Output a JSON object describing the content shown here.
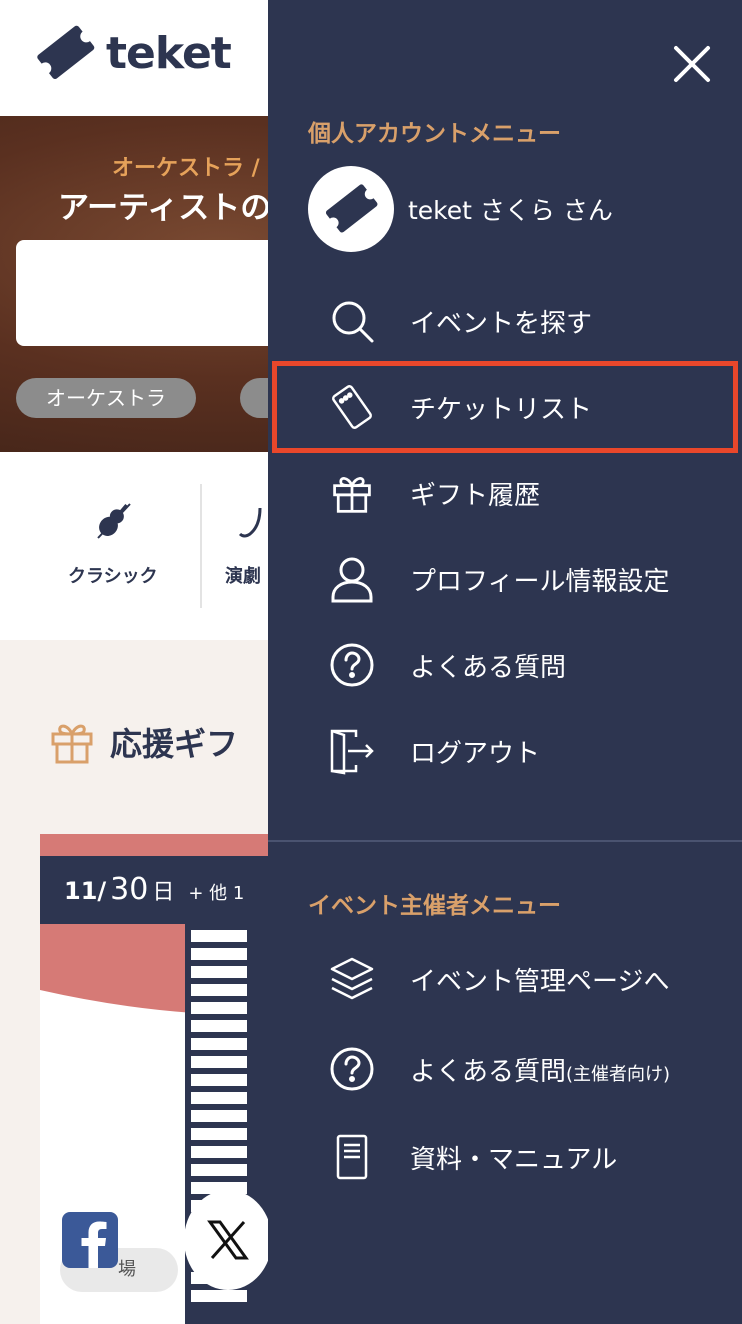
{
  "header": {
    "logo_text": "teket"
  },
  "hero": {
    "subtitle": "オーケストラ /",
    "title": "アーティストの",
    "chips": [
      "オーケストラ"
    ]
  },
  "categories": [
    {
      "label": "クラシック",
      "icon": "violin-icon"
    },
    {
      "label": "演劇",
      "icon": "theater-mask-icon"
    }
  ],
  "gift_section": {
    "heading": "応援ギフ"
  },
  "event_card": {
    "date_month_day": "11/",
    "date_day": "30",
    "weekday": "日",
    "more": "+ 他 1",
    "venue_partial": "場"
  },
  "drawer": {
    "personal_menu_title": "個人アカウントメニュー",
    "user_name": "teket さくら さん",
    "personal_items": [
      {
        "label": "イベントを探す",
        "icon": "search-icon"
      },
      {
        "label": "チケットリスト",
        "icon": "ticket-icon",
        "highlighted": true
      },
      {
        "label": "ギフト履歴",
        "icon": "gift-icon"
      },
      {
        "label": "プロフィール情報設定",
        "icon": "user-icon"
      },
      {
        "label": "よくある質問",
        "icon": "question-icon"
      },
      {
        "label": "ログアウト",
        "icon": "logout-icon"
      }
    ],
    "organizer_menu_title": "イベント主催者メニュー",
    "organizer_items": [
      {
        "label": "イベント管理ページへ",
        "icon": "layers-icon"
      },
      {
        "label": "よくある質問",
        "label_suffix": "(主催者向け)",
        "icon": "question-icon"
      },
      {
        "label": "資料・マニュアル",
        "icon": "document-icon"
      }
    ]
  },
  "colors": {
    "navy": "#2d3550",
    "accent_orange": "#d9a06a",
    "highlight_red": "#e9472b",
    "card_pink": "#d67a76"
  }
}
